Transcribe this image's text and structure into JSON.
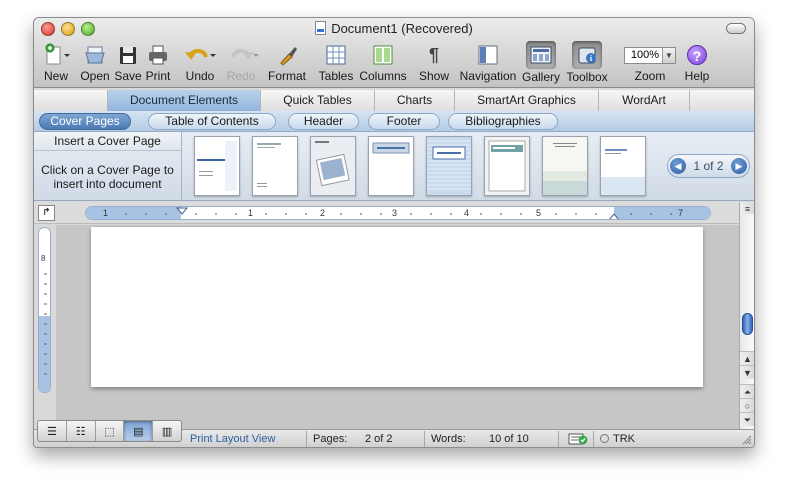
{
  "window": {
    "title": "Document1 (Recovered)"
  },
  "toolbar": {
    "items": [
      {
        "label": "New",
        "icon": "new-document-icon"
      },
      {
        "label": "Open",
        "icon": "open-folder-icon"
      },
      {
        "label": "Save",
        "icon": "save-disk-icon"
      },
      {
        "label": "Print",
        "icon": "printer-icon"
      },
      {
        "label": "Undo",
        "icon": "undo-arrow-icon"
      },
      {
        "label": "Redo",
        "icon": "redo-arrow-icon",
        "disabled": true
      },
      {
        "label": "Format",
        "icon": "format-brush-icon"
      },
      {
        "label": "Tables",
        "icon": "table-grid-icon"
      },
      {
        "label": "Columns",
        "icon": "columns-icon"
      },
      {
        "label": "Show",
        "icon": "pilcrow-icon"
      },
      {
        "label": "Navigation",
        "icon": "navigation-pane-icon"
      },
      {
        "label": "Gallery",
        "icon": "gallery-icon",
        "active": true
      },
      {
        "label": "Toolbox",
        "icon": "toolbox-icon",
        "active": true
      },
      {
        "label": "Zoom",
        "icon": "zoom-dropdown"
      },
      {
        "label": "Help",
        "icon": "help-icon"
      }
    ],
    "zoom_value": "100%",
    "pilcrow": "¶",
    "help_glyph": "?"
  },
  "ribbon_tabs": [
    "Document Elements",
    "Quick Tables",
    "Charts",
    "SmartArt Graphics",
    "WordArt"
  ],
  "sub_tabs": [
    "Cover Pages",
    "Table of Contents",
    "Header",
    "Footer",
    "Bibliographies"
  ],
  "gallery": {
    "insert_label": "Insert a Cover Page",
    "hint_line1": "Click on a Cover Page to",
    "hint_line2": "insert into document",
    "pager": "1 of 2",
    "thumbnail_count": 8
  },
  "ruler": {
    "numbers": [
      "1",
      "1",
      "2",
      "3",
      "4",
      "5",
      "7"
    ],
    "tab_selector": "↱"
  },
  "vertical_ruler": {
    "mark": "8"
  },
  "statusbar": {
    "view_name": "Print Layout View",
    "pages_label": "Pages:",
    "pages_value": "2 of 2",
    "words_label": "Words:",
    "words_value": "10 of 10",
    "trk": "TRK"
  },
  "colors": {
    "accent_blue": "#4b79b5",
    "ribbon_blue": "#b3cbe4",
    "view_label": "#2a5fa0"
  }
}
